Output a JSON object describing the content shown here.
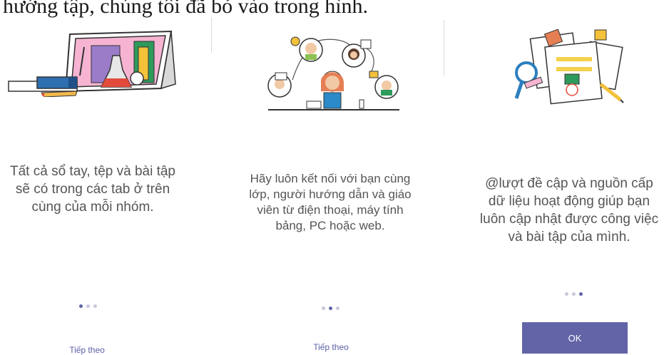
{
  "top_text": "hướng tập, chúng tôi đã bỏ vào trong hình.",
  "panels": [
    {
      "lines": [
        "Tất cả sổ tay, tệp và bài tập",
        "sẽ có trong các tab ở trên",
        "cùng của mỗi nhóm."
      ],
      "page": 1,
      "button": "Tiếp theo"
    },
    {
      "lines": [
        "Hãy luôn kết nối với bạn cùng",
        "lớp, người hướng dẫn và giáo",
        "viên từ điện thoại, máy tính",
        "bảng, PC hoặc web."
      ],
      "page": 2,
      "button": "Tiếp theo"
    },
    {
      "lines": [
        "@lượt đề cập và nguồn cấp",
        "dữ liệu hoạt động giúp bạn",
        "luôn cập nhật được công việc",
        "và bài tập của mình."
      ],
      "page": 3,
      "button": "OK"
    }
  ],
  "page_count": 3,
  "colors": {
    "accent": "#6264a7",
    "dot_inactive": "#c9c7dd",
    "text": "#555555"
  }
}
